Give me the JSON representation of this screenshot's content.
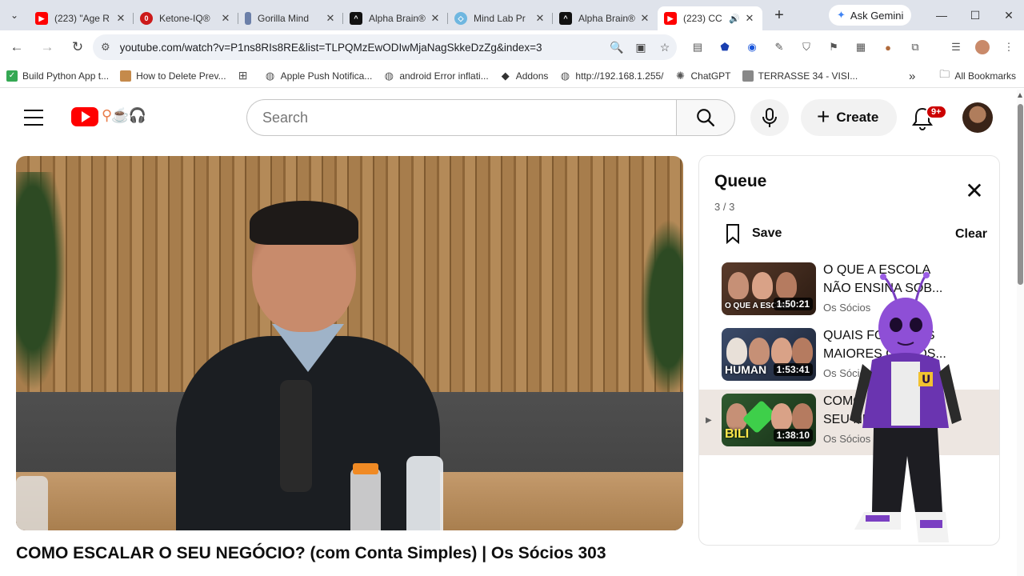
{
  "browser": {
    "tabs": [
      {
        "title": "(223) \"Age R",
        "favicon": "youtube-icon",
        "color": "#ff0000"
      },
      {
        "title": "Ketone-IQ®",
        "favicon": "ketone-icon",
        "color": "#cc1a1a"
      },
      {
        "title": "Gorilla Mind",
        "favicon": "gorilla-icon",
        "color": "#6b7fa8"
      },
      {
        "title": "Alpha Brain®",
        "favicon": "alpha-brain-icon",
        "color": "#111111"
      },
      {
        "title": "Mind Lab Pr",
        "favicon": "mindlab-icon",
        "color": "#6fb7e0"
      },
      {
        "title": "Alpha Brain®",
        "favicon": "alpha-brain-icon",
        "color": "#111111"
      },
      {
        "title": "(223) CC",
        "favicon": "youtube-icon",
        "color": "#ff0000",
        "active": true
      }
    ],
    "ask_gemini": "Ask Gemini",
    "url": "youtube.com/watch?v=P1ns8RIs8RE&list=TLPQMzEwODIwMjaNagSkkeDzZg&index=3",
    "bookmarks": [
      {
        "label": "Build Python App t...",
        "icon": "check-icon",
        "color": "#34a853"
      },
      {
        "label": "How to Delete Prev...",
        "icon": "page-icon",
        "color": "#c58a4b"
      },
      {
        "label": "",
        "icon": "apps-icon",
        "color": "#555555"
      },
      {
        "label": "Apple Push Notifica...",
        "icon": "globe-icon",
        "color": "#555555"
      },
      {
        "label": "android Error inflati...",
        "icon": "globe-icon",
        "color": "#555555"
      },
      {
        "label": "Addons",
        "icon": "diamond-icon",
        "color": "#333333"
      },
      {
        "label": "http://192.168.1.255/",
        "icon": "globe-icon",
        "color": "#555555"
      },
      {
        "label": "ChatGPT",
        "icon": "chatgpt-icon",
        "color": "#555555"
      },
      {
        "label": "TERRASSE 34 - VISI...",
        "icon": "page-icon",
        "color": "#777777"
      }
    ],
    "all_bookmarks": "All Bookmarks",
    "more_bookmarks": "»"
  },
  "youtube": {
    "search_placeholder": "Search",
    "create_label": "Create",
    "notif_badge": "9+",
    "video_title": "COMO ESCALAR O SEU NEGÓCIO? (com Conta Simples) | Os Sócios 303",
    "queue": {
      "title": "Queue",
      "count": "3 / 3",
      "save_label": "Save",
      "clear_label": "Clear",
      "items": [
        {
          "title": "O QUE A ESCOLA NÃO ENSINA SOB...",
          "channel": "Os Sócios",
          "duration": "1:50:21",
          "thumb_text": "O QUE A ESCOLA",
          "thumb_color": "#5a3b2b",
          "active": false
        },
        {
          "title": "QUAIS FORAM OS MAIORES GÊNIOS...",
          "channel": "Os Sócios",
          "duration": "1:53:41",
          "thumb_text": "HUMAN",
          "thumb_color": "#3b4b6a",
          "active": false
        },
        {
          "title": "COMO ESCALAR O SEU NEGÓCIO? (com Conta...",
          "channel": "Os Sócios",
          "duration": "1:38:10",
          "thumb_text": "BILI",
          "thumb_color": "#2f5a2f",
          "active": true
        }
      ]
    }
  },
  "colors": {
    "youtube_red": "#ff0000",
    "badge_red": "#cc0000",
    "active_row": "#ede6e1"
  }
}
